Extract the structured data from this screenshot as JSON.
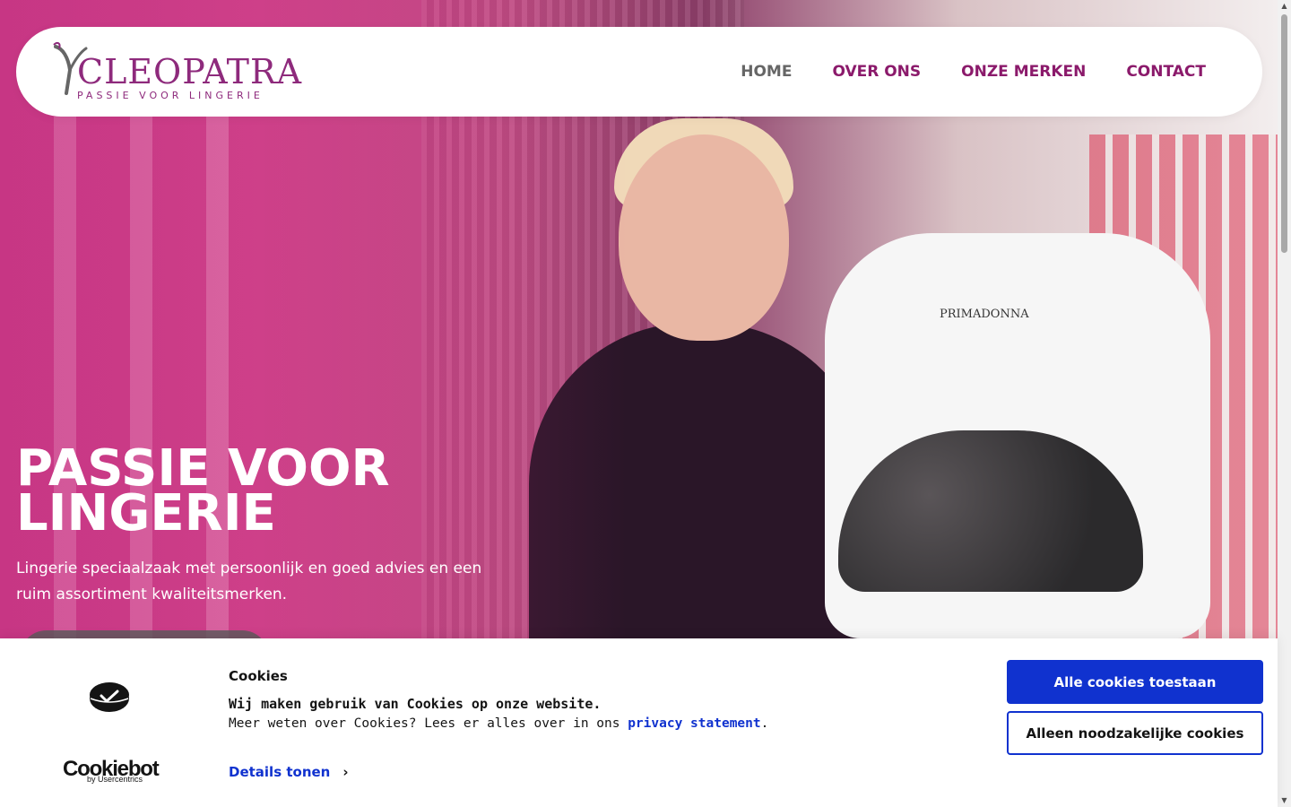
{
  "colors": {
    "brand": "#8e2a7c",
    "nav": "#8b1a6b",
    "nav_active": "#666666",
    "cookie_accent": "#1032cf",
    "hero_overlay": "#c42c82"
  },
  "header": {
    "logo": {
      "title": "CLEOPATRA",
      "tagline": "PASSIE VOOR LINGERIE",
      "icon": "stylized-y-logo-icon"
    },
    "nav": [
      {
        "label": "HOME",
        "active": true
      },
      {
        "label": "OVER ONS",
        "active": false
      },
      {
        "label": "ONZE MERKEN",
        "active": false
      },
      {
        "label": "CONTACT",
        "active": false
      }
    ]
  },
  "hero": {
    "title_line1": "PASSIE VOOR",
    "title_line2": "LINGERIE",
    "subtitle": "Lingerie speciaalzaak met persoonlijk en goed advies en een ruim assortiment kwaliteitsmerken.",
    "mannequin_brand": "PRIMADONNA"
  },
  "cookie_banner": {
    "provider_logo": "Cookiebot",
    "provider_by": "by Usercentrics",
    "title": "Cookies",
    "lead": "Wij maken gebruik van Cookies op onze website.",
    "text_prefix": "Meer weten over Cookies? Lees er alles over in ons ",
    "link_label": "privacy statement",
    "text_suffix": ".",
    "details_label": "Details tonen",
    "allow_all_label": "Alle cookies toestaan",
    "necessary_label": "Alleen noodzakelijke cookies"
  }
}
